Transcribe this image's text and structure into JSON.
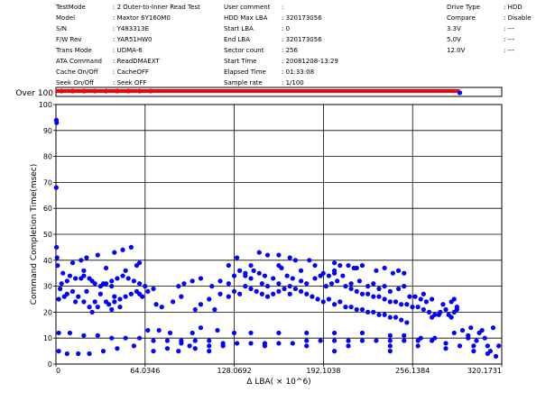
{
  "info": {
    "col1": [
      {
        "label": "TestMode",
        "value": ": 2 Outer-to-Inner Read Test"
      },
      {
        "label": "Model",
        "value": ": Maxtor 6Y160M0"
      },
      {
        "label": "S/N",
        "value": ": Y483313E"
      },
      {
        "label": "F/W Rev",
        "value": ": YAR51HW0"
      },
      {
        "label": "Trans Mode",
        "value": ": UDMA-6"
      },
      {
        "label": "ATA Command",
        "value": ": ReadDMAEXT"
      },
      {
        "label": "Cache On/Off",
        "value": ": CacheOFF"
      },
      {
        "label": "Seek On/Off",
        "value": ": Seek OFF"
      }
    ],
    "col2": [
      {
        "label": "User comment",
        "value": ":"
      },
      {
        "label": "HDD Max LBA",
        "value": ": 320173056"
      },
      {
        "label": "Start LBA",
        "value": ": 0"
      },
      {
        "label": "End LBA",
        "value": ": 320173056"
      },
      {
        "label": "Sector count",
        "value": ": 256"
      },
      {
        "label": "Start Time",
        "value": ": 20081208-13:29"
      },
      {
        "label": "Elapsed Time",
        "value": ": 01:33:08"
      },
      {
        "label": "Sample rate",
        "value": ": 1/100"
      }
    ],
    "col3": [
      {
        "label": "Drive Type",
        "value": ": HDD"
      },
      {
        "label": "Compare",
        "value": ": Disable"
      },
      {
        "label": "3.3V",
        "value": ": ---"
      },
      {
        "label": "5.0V",
        "value": ": ---"
      },
      {
        "label": "12.0V",
        "value": ": ---"
      }
    ]
  },
  "chart_data": {
    "type": "scatter",
    "xlabel": "Δ LBA( × 10^6)",
    "ylabel": "Command Completion Time(msec)",
    "over_label": "Over 100",
    "xlim": [
      0,
      320.1731
    ],
    "ylim": [
      0,
      100
    ],
    "xticks": [
      0,
      64.0346,
      128.0692,
      192.1038,
      256.1384,
      320.1731
    ],
    "xtick_labels": [
      "0",
      "64.0346",
      "128.0692",
      "192.1038",
      "256.1384",
      "320.1731"
    ],
    "yticks": [
      0,
      10,
      20,
      30,
      40,
      50,
      60,
      70,
      80,
      90,
      100
    ],
    "ytick_labels": [
      "0",
      "10",
      "20",
      "30",
      "40",
      "50",
      "60",
      "70",
      "80",
      "90",
      "100"
    ],
    "grid": true,
    "point_color": "#0000ff",
    "over_color": "#ff0000",
    "over_range": [
      0,
      290
    ],
    "points": [
      [
        0.3,
        94
      ],
      [
        0.5,
        93
      ],
      [
        0.2,
        68
      ],
      [
        0.4,
        45
      ],
      [
        0.8,
        41
      ],
      [
        1.2,
        38
      ],
      [
        5,
        35
      ],
      [
        10,
        34
      ],
      [
        18,
        33
      ],
      [
        26,
        32
      ],
      [
        34,
        31
      ],
      [
        40,
        30
      ],
      [
        3,
        29
      ],
      [
        12,
        28
      ],
      [
        22,
        28
      ],
      [
        32,
        27
      ],
      [
        42,
        26
      ],
      [
        2,
        25
      ],
      [
        14,
        24
      ],
      [
        28,
        24
      ],
      [
        38,
        23
      ],
      [
        46,
        22
      ],
      [
        2,
        12
      ],
      [
        10,
        12
      ],
      [
        20,
        11
      ],
      [
        30,
        11
      ],
      [
        40,
        10
      ],
      [
        50,
        10
      ],
      [
        60,
        10
      ],
      [
        70,
        9
      ],
      [
        2,
        5
      ],
      [
        8,
        4
      ],
      [
        16,
        4
      ],
      [
        24,
        4
      ],
      [
        34,
        5
      ],
      [
        44,
        6
      ],
      [
        56,
        7
      ],
      [
        12,
        39
      ],
      [
        18,
        40
      ],
      [
        22,
        41
      ],
      [
        30,
        42
      ],
      [
        42,
        43
      ],
      [
        48,
        44
      ],
      [
        54,
        45
      ],
      [
        58,
        38
      ],
      [
        60,
        39
      ],
      [
        50,
        36
      ],
      [
        20,
        36
      ],
      [
        36,
        37
      ],
      [
        26,
        20
      ],
      [
        40,
        21
      ],
      [
        80,
        9
      ],
      [
        90,
        9
      ],
      [
        100,
        9
      ],
      [
        110,
        9
      ],
      [
        120,
        8
      ],
      [
        130,
        8
      ],
      [
        140,
        8
      ],
      [
        150,
        8
      ],
      [
        160,
        8
      ],
      [
        170,
        8
      ],
      [
        180,
        9
      ],
      [
        190,
        9
      ],
      [
        200,
        9
      ],
      [
        210,
        9
      ],
      [
        220,
        9
      ],
      [
        230,
        9
      ],
      [
        240,
        9
      ],
      [
        250,
        9
      ],
      [
        260,
        9
      ],
      [
        270,
        9
      ],
      [
        280,
        8
      ],
      [
        290,
        7
      ],
      [
        300,
        7
      ],
      [
        310,
        7
      ],
      [
        318,
        7
      ],
      [
        66,
        13
      ],
      [
        74,
        13
      ],
      [
        82,
        12
      ],
      [
        98,
        12
      ],
      [
        104,
        14
      ],
      [
        116,
        13
      ],
      [
        128,
        12
      ],
      [
        140,
        12
      ],
      [
        160,
        12
      ],
      [
        180,
        12
      ],
      [
        200,
        12
      ],
      [
        220,
        12
      ],
      [
        240,
        11
      ],
      [
        250,
        11
      ],
      [
        262,
        10
      ],
      [
        272,
        10
      ],
      [
        286,
        12
      ],
      [
        296,
        11
      ],
      [
        306,
        13
      ],
      [
        314,
        14
      ],
      [
        64,
        30
      ],
      [
        66,
        28
      ],
      [
        70,
        29
      ],
      [
        88,
        30
      ],
      [
        92,
        31
      ],
      [
        98,
        32
      ],
      [
        104,
        33
      ],
      [
        112,
        30
      ],
      [
        118,
        32
      ],
      [
        124,
        31
      ],
      [
        128,
        34
      ],
      [
        132,
        36
      ],
      [
        136,
        35
      ],
      [
        140,
        38
      ],
      [
        142,
        36
      ],
      [
        146,
        35
      ],
      [
        150,
        34
      ],
      [
        156,
        33
      ],
      [
        160,
        38
      ],
      [
        162,
        37
      ],
      [
        166,
        34
      ],
      [
        170,
        33
      ],
      [
        176,
        32
      ],
      [
        180,
        31
      ],
      [
        186,
        33
      ],
      [
        190,
        34
      ],
      [
        194,
        30
      ],
      [
        198,
        31
      ],
      [
        202,
        32
      ],
      [
        208,
        30
      ],
      [
        212,
        29
      ],
      [
        216,
        28
      ],
      [
        220,
        27
      ],
      [
        224,
        27
      ],
      [
        228,
        26
      ],
      [
        232,
        26
      ],
      [
        236,
        25
      ],
      [
        240,
        24
      ],
      [
        244,
        24
      ],
      [
        248,
        23
      ],
      [
        252,
        23
      ],
      [
        256,
        22
      ],
      [
        260,
        22
      ],
      [
        264,
        21
      ],
      [
        268,
        20
      ],
      [
        270,
        18
      ],
      [
        275,
        19
      ],
      [
        278,
        23
      ],
      [
        284,
        24
      ],
      [
        286,
        25
      ],
      [
        288,
        21
      ],
      [
        136,
        30
      ],
      [
        140,
        29
      ],
      [
        144,
        28
      ],
      [
        148,
        27
      ],
      [
        152,
        26
      ],
      [
        156,
        27
      ],
      [
        160,
        28
      ],
      [
        164,
        29
      ],
      [
        168,
        30
      ],
      [
        172,
        29
      ],
      [
        176,
        28
      ],
      [
        180,
        27
      ],
      [
        184,
        26
      ],
      [
        188,
        25
      ],
      [
        192,
        24
      ],
      [
        196,
        25
      ],
      [
        200,
        23
      ],
      [
        204,
        24
      ],
      [
        208,
        22
      ],
      [
        212,
        22
      ],
      [
        216,
        21
      ],
      [
        220,
        21
      ],
      [
        224,
        20
      ],
      [
        228,
        20
      ],
      [
        232,
        19
      ],
      [
        236,
        19
      ],
      [
        240,
        18
      ],
      [
        244,
        18
      ],
      [
        248,
        17
      ],
      [
        252,
        16
      ],
      [
        136,
        34
      ],
      [
        140,
        33
      ],
      [
        148,
        31
      ],
      [
        152,
        30
      ],
      [
        160,
        31
      ],
      [
        168,
        27
      ],
      [
        176,
        36
      ],
      [
        186,
        38
      ],
      [
        192,
        35
      ],
      [
        200,
        36
      ],
      [
        210,
        38
      ],
      [
        216,
        37
      ],
      [
        110,
        25
      ],
      [
        118,
        27
      ],
      [
        124,
        26
      ],
      [
        128,
        28
      ],
      [
        132,
        27
      ],
      [
        104,
        23
      ],
      [
        90,
        26
      ],
      [
        84,
        24
      ],
      [
        76,
        22
      ],
      [
        72,
        23
      ],
      [
        100,
        21
      ],
      [
        114,
        21
      ],
      [
        124,
        38
      ],
      [
        130,
        41
      ],
      [
        146,
        43
      ],
      [
        152,
        42
      ],
      [
        160,
        42
      ],
      [
        168,
        41
      ],
      [
        172,
        40
      ],
      [
        182,
        40
      ],
      [
        200,
        39
      ],
      [
        204,
        38
      ],
      [
        214,
        37
      ],
      [
        220,
        38
      ],
      [
        230,
        36
      ],
      [
        236,
        37
      ],
      [
        242,
        35
      ],
      [
        246,
        36
      ],
      [
        250,
        35
      ],
      [
        258,
        26
      ],
      [
        264,
        27
      ],
      [
        270,
        25
      ],
      [
        280,
        21
      ],
      [
        282,
        19
      ],
      [
        284,
        18
      ],
      [
        286,
        20
      ],
      [
        288,
        22
      ],
      [
        276,
        20
      ],
      [
        272,
        19
      ],
      [
        266,
        24
      ],
      [
        262,
        25
      ],
      [
        254,
        26
      ],
      [
        250,
        30
      ],
      [
        246,
        29
      ],
      [
        240,
        28
      ],
      [
        236,
        30
      ],
      [
        232,
        29
      ],
      [
        228,
        31
      ],
      [
        224,
        30
      ],
      [
        218,
        32
      ],
      [
        212,
        31
      ],
      [
        206,
        34
      ],
      [
        200,
        35
      ],
      [
        196,
        34
      ],
      [
        6,
        26
      ],
      [
        8,
        27
      ],
      [
        16,
        26
      ],
      [
        20,
        24
      ],
      [
        24,
        22
      ],
      [
        30,
        22
      ],
      [
        36,
        24
      ],
      [
        42,
        24
      ],
      [
        46,
        25
      ],
      [
        50,
        26
      ],
      [
        54,
        27
      ],
      [
        58,
        28
      ],
      [
        60,
        27
      ],
      [
        62,
        26
      ],
      [
        4,
        31
      ],
      [
        8,
        32
      ],
      [
        14,
        33
      ],
      [
        20,
        34
      ],
      [
        24,
        33
      ],
      [
        28,
        31
      ],
      [
        32,
        30
      ],
      [
        36,
        31
      ],
      [
        40,
        32
      ],
      [
        44,
        33
      ],
      [
        48,
        34
      ],
      [
        52,
        33
      ],
      [
        56,
        32
      ],
      [
        60,
        31
      ],
      [
        90,
        8
      ],
      [
        96,
        7
      ],
      [
        110,
        7
      ],
      [
        120,
        7
      ],
      [
        150,
        7
      ],
      [
        180,
        7
      ],
      [
        210,
        7
      ],
      [
        240,
        7
      ],
      [
        260,
        7
      ],
      [
        280,
        6
      ],
      [
        300,
        5
      ],
      [
        310,
        4
      ],
      [
        316,
        3
      ],
      [
        312,
        5
      ],
      [
        70,
        5
      ],
      [
        80,
        6
      ],
      [
        88,
        5
      ],
      [
        100,
        6
      ],
      [
        110,
        5
      ],
      [
        200,
        5
      ],
      [
        240,
        5
      ],
      [
        296,
        10
      ],
      [
        302,
        9
      ],
      [
        308,
        10
      ],
      [
        292,
        13
      ],
      [
        298,
        14
      ],
      [
        304,
        12
      ]
    ]
  }
}
